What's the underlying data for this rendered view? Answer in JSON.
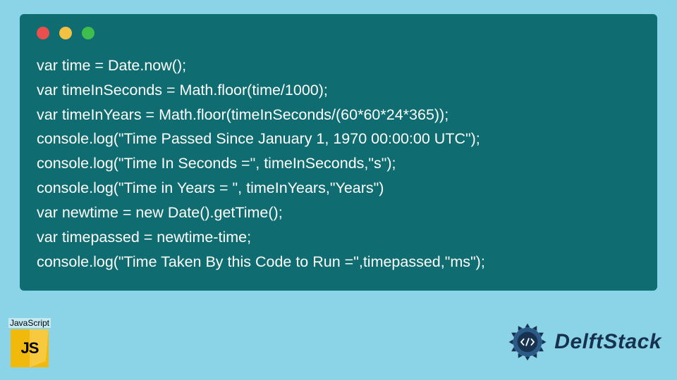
{
  "code": {
    "lines": [
      "var time = Date.now();",
      "var timeInSeconds = Math.floor(time/1000);",
      "var timeInYears = Math.floor(timeInSeconds/(60*60*24*365));",
      "console.log(\"Time Passed Since January 1, 1970 00:00:00 UTC\");",
      "console.log(\"Time In Seconds =\", timeInSeconds,\"s\");",
      "console.log(\"Time in Years = \", timeInYears,\"Years\")",
      "var newtime = new Date().getTime();",
      "var timepassed = newtime-time;",
      "console.log(\"Time Taken By this Code to Run =\",timepassed,\"ms\");"
    ]
  },
  "badge": {
    "label": "JavaScript",
    "icon_text": "JS"
  },
  "brand": {
    "name": "DelftStack"
  },
  "colors": {
    "page_bg": "#8bd3e6",
    "window_bg": "#0f6c70",
    "code_fg": "#ffffff",
    "dot_red": "#e94f4f",
    "dot_yellow": "#f3c142",
    "dot_green": "#3fbe4e",
    "js_yellow": "#f0b90b",
    "brand_navy": "#16324f"
  }
}
